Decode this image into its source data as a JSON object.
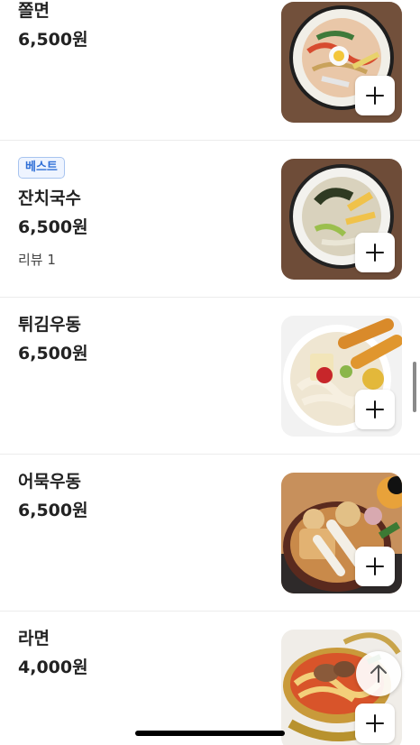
{
  "menu": {
    "items": [
      {
        "name": "쫄면",
        "price": "6,500원",
        "badge": "",
        "review": "",
        "image_icon": "jjolmyeon-dish-image"
      },
      {
        "name": "잔치국수",
        "price": "6,500원",
        "badge": "베스트",
        "review": "리뷰 1",
        "image_icon": "janchi-guksu-dish-image"
      },
      {
        "name": "튀김우동",
        "price": "6,500원",
        "badge": "",
        "review": "",
        "image_icon": "tempura-udon-dish-image"
      },
      {
        "name": "어묵우동",
        "price": "6,500원",
        "badge": "",
        "review": "",
        "image_icon": "fishcake-udon-dish-image"
      },
      {
        "name": "라면",
        "price": "4,000원",
        "badge": "",
        "review": "",
        "image_icon": "ramyeon-dish-image"
      }
    ]
  },
  "controls": {
    "add_icon": "plus-icon",
    "scroll_top_icon": "arrow-up-icon"
  },
  "colors": {
    "badge_text": "#2f6fd6",
    "badge_bg": "#eef4ff",
    "divider": "#ececec"
  }
}
